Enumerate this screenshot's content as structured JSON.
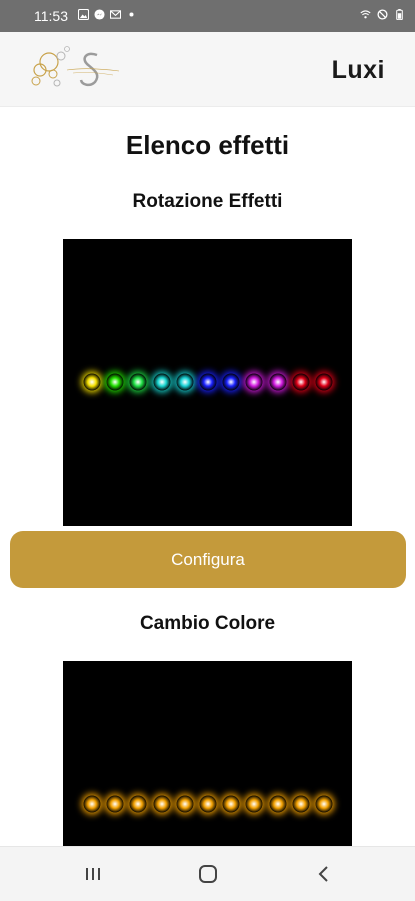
{
  "status_bar": {
    "time": "11:53",
    "left_icons": [
      "photo-icon",
      "messenger-icon",
      "mail-icon",
      "dot-icon"
    ],
    "right_icons": [
      "wifi-icon",
      "do-not-disturb-icon",
      "battery-icon"
    ]
  },
  "header": {
    "logo_icon": "brand-logo",
    "app_name": "Luxi"
  },
  "main": {
    "title": "Elenco effetti",
    "effects": [
      {
        "name": "Rotazione Effetti",
        "led_colors": [
          "#f5e000",
          "#22e000",
          "#1ee044",
          "#18d6d0",
          "#18d2d6",
          "#1a22ff",
          "#1a22ff",
          "#d21ae0",
          "#d21ae0",
          "#e00018",
          "#e00018"
        ]
      },
      {
        "name": "Cambio Colore",
        "led_colors": [
          "#f2a000",
          "#f2a000",
          "#f2a000",
          "#f2a000",
          "#f2a000",
          "#f2a000",
          "#f2a000",
          "#f2a000",
          "#f2a000",
          "#f2a000",
          "#f2a000"
        ]
      }
    ],
    "configure_label": "Configura"
  },
  "colors": {
    "accent": "#c49a3b",
    "preview_background": "#000000"
  },
  "nav_bar": {
    "buttons": [
      "recent-apps-icon",
      "home-icon",
      "back-icon"
    ]
  }
}
